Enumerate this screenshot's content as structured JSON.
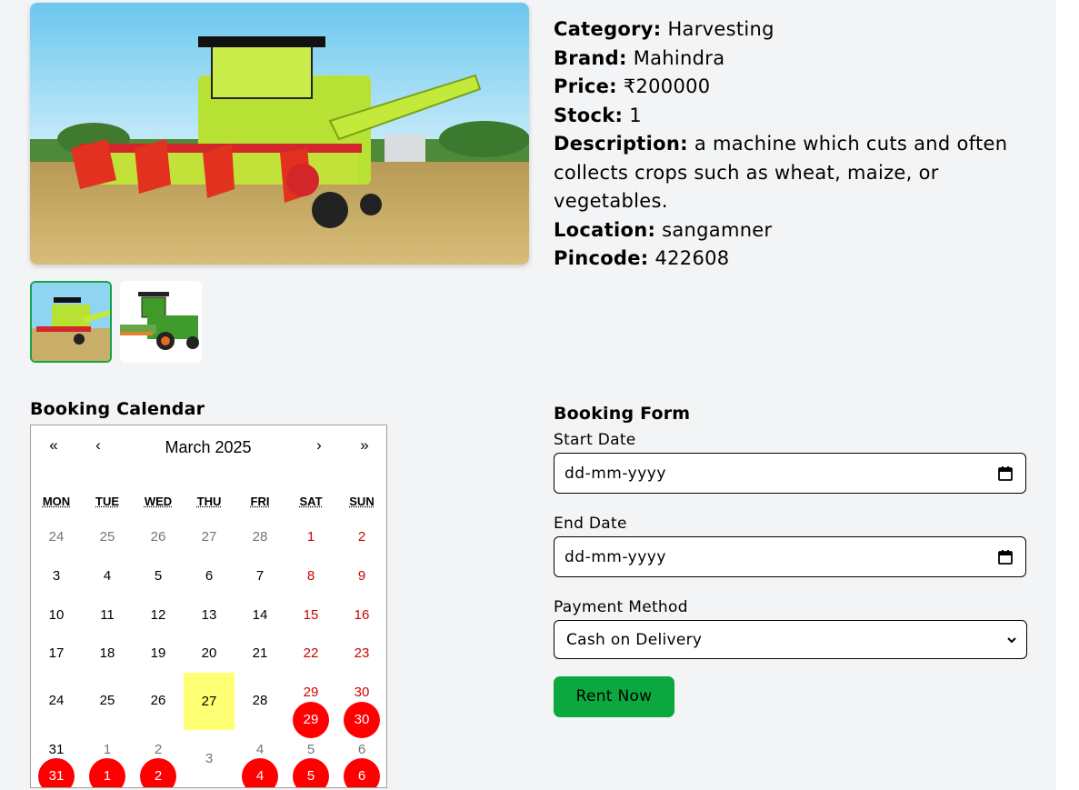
{
  "details": {
    "category_label": "Category:",
    "category_value": "Harvesting",
    "brand_label": "Brand:",
    "brand_value": "Mahindra",
    "price_label": "Price:",
    "price_value": "₹200000",
    "stock_label": "Stock:",
    "stock_value": "1",
    "description_label": "Description:",
    "description_value": "a machine which cuts and often collects crops such as wheat, maize, or vegetables.",
    "location_label": "Location:",
    "location_value": "sangamner",
    "pincode_label": "Pincode:",
    "pincode_value": "422608"
  },
  "calendar": {
    "title": "Booking Calendar",
    "month_label": "March 2025",
    "nav": {
      "prev_year": "«",
      "prev_month": "‹",
      "next_month": "›",
      "next_year": "»"
    },
    "weekdays": [
      "MON",
      "TUE",
      "WED",
      "THU",
      "FRI",
      "SAT",
      "SUN"
    ],
    "weeks": [
      [
        {
          "d": "24",
          "t": "other"
        },
        {
          "d": "25",
          "t": "other"
        },
        {
          "d": "26",
          "t": "other"
        },
        {
          "d": "27",
          "t": "other"
        },
        {
          "d": "28",
          "t": "other"
        },
        {
          "d": "1",
          "t": "weekend"
        },
        {
          "d": "2",
          "t": "weekend"
        }
      ],
      [
        {
          "d": "3",
          "t": "normal"
        },
        {
          "d": "4",
          "t": "normal"
        },
        {
          "d": "5",
          "t": "normal"
        },
        {
          "d": "6",
          "t": "normal"
        },
        {
          "d": "7",
          "t": "normal"
        },
        {
          "d": "8",
          "t": "weekend"
        },
        {
          "d": "9",
          "t": "weekend"
        }
      ],
      [
        {
          "d": "10",
          "t": "normal"
        },
        {
          "d": "11",
          "t": "normal"
        },
        {
          "d": "12",
          "t": "normal"
        },
        {
          "d": "13",
          "t": "normal"
        },
        {
          "d": "14",
          "t": "normal"
        },
        {
          "d": "15",
          "t": "weekend"
        },
        {
          "d": "16",
          "t": "weekend"
        }
      ],
      [
        {
          "d": "17",
          "t": "normal"
        },
        {
          "d": "18",
          "t": "normal"
        },
        {
          "d": "19",
          "t": "normal"
        },
        {
          "d": "20",
          "t": "normal"
        },
        {
          "d": "21",
          "t": "normal"
        },
        {
          "d": "22",
          "t": "weekend"
        },
        {
          "d": "23",
          "t": "weekend"
        }
      ],
      [
        {
          "d": "24",
          "t": "normal"
        },
        {
          "d": "25",
          "t": "normal"
        },
        {
          "d": "26",
          "t": "normal"
        },
        {
          "d": "27",
          "t": "today"
        },
        {
          "d": "28",
          "t": "normal"
        },
        {
          "d": "29",
          "t": "weekend",
          "booked": "29"
        },
        {
          "d": "30",
          "t": "weekend",
          "booked": "30"
        }
      ],
      [
        {
          "d": "31",
          "t": "normal",
          "booked": "31"
        },
        {
          "d": "1",
          "t": "other",
          "booked": "1"
        },
        {
          "d": "2",
          "t": "other",
          "booked": "2"
        },
        {
          "d": "3",
          "t": "other"
        },
        {
          "d": "4",
          "t": "other",
          "booked": "4"
        },
        {
          "d": "5",
          "t": "other",
          "booked": "5"
        },
        {
          "d": "6",
          "t": "other",
          "booked": "6"
        }
      ]
    ],
    "colors": {
      "weekend": "#d10000",
      "other_month": "#757575",
      "today_highlight": "#ffff76",
      "booked": "#ff0000"
    }
  },
  "form": {
    "title": "Booking Form",
    "start_label": "Start Date",
    "start_placeholder": "dd-mm-yyyy",
    "end_label": "End Date",
    "end_placeholder": "dd-mm-yyyy",
    "payment_label": "Payment Method",
    "payment_selected": "Cash on Delivery",
    "submit_label": "Rent Now",
    "submit_color": "#0aa83f"
  },
  "images": {
    "main_icon": "harvester-photo",
    "thumbnails": [
      "harvester-thumb-1",
      "harvester-thumb-2"
    ],
    "selected_thumb_border": "#16a34a"
  }
}
